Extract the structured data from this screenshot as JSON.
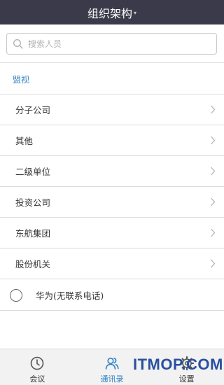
{
  "header": {
    "title": "组织架构",
    "caret": "▾"
  },
  "search": {
    "placeholder": "搜索人员"
  },
  "section": {
    "label": "盟视"
  },
  "list": {
    "items": [
      {
        "label": "分子公司"
      },
      {
        "label": "其他"
      },
      {
        "label": "二级单位"
      },
      {
        "label": "投资公司"
      },
      {
        "label": "东航集团"
      },
      {
        "label": "股份机关"
      }
    ]
  },
  "contact": {
    "label": "华为(无联系电话)",
    "selected": false
  },
  "tabbar": {
    "tabs": [
      {
        "label": "会议",
        "icon": "clock-icon",
        "active": false
      },
      {
        "label": "通讯录",
        "icon": "contacts-icon",
        "active": true
      },
      {
        "label": "设置",
        "icon": "gear-icon",
        "active": false
      }
    ]
  },
  "watermark": {
    "text": "ITMOP.COM"
  },
  "colors": {
    "header_bg": "#3a3a4a",
    "accent": "#2f7fc7",
    "section_label": "#3a86c8",
    "watermark": "#2a4fa0"
  }
}
